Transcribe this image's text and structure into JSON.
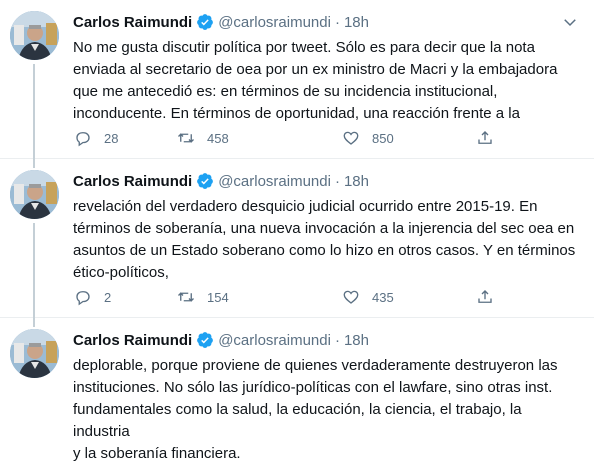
{
  "author": {
    "name": "Carlos Raimundi",
    "handle": "@carlosraimundi",
    "verified": true
  },
  "dot": "·",
  "tweets": [
    {
      "time": "18h",
      "text": "No me gusta discutir política por tweet. Sólo es para decir que la nota\nenviada al secretario de oea por un ex ministro de Macri y la embajadora\nque me antecedió es: en términos de su incidencia institucional,\ninconducente. En términos de oportunidad, una reacción frente a la",
      "replies": "28",
      "retweets": "458",
      "likes": "850"
    },
    {
      "time": "18h",
      "text": "revelación del verdadero desquicio judicial ocurrido entre 2015-19. En\ntérminos de soberanía, una nueva invocación a la injerencia del sec oea en\nasuntos de un Estado soberano como lo hizo en otros casos. Y en términos\nético-políticos,",
      "replies": "2",
      "retweets": "154",
      "likes": "435"
    },
    {
      "time": "18h",
      "text": "deplorable, porque proviene de quienes verdaderamente destruyeron las\ninstituciones. No sólo las jurídico-políticas con el lawfare, sino otras inst.\nfundamentales como la salud, la educación, la ciencia, el trabajo, la industria\ny la soberanía financiera.",
      "replies": "",
      "retweets": "",
      "likes": ""
    }
  ],
  "icons": {
    "reply": "reply-icon",
    "retweet": "retweet-icon",
    "like": "like-icon",
    "share": "share-icon",
    "caret": "chevron-down-icon",
    "verified": "verified-badge-icon"
  },
  "colors": {
    "text": "#0f1419",
    "secondary": "#5b7083",
    "verified": "#1da1f2",
    "border": "#ebeef0",
    "thread_line": "#c4cfd6"
  }
}
